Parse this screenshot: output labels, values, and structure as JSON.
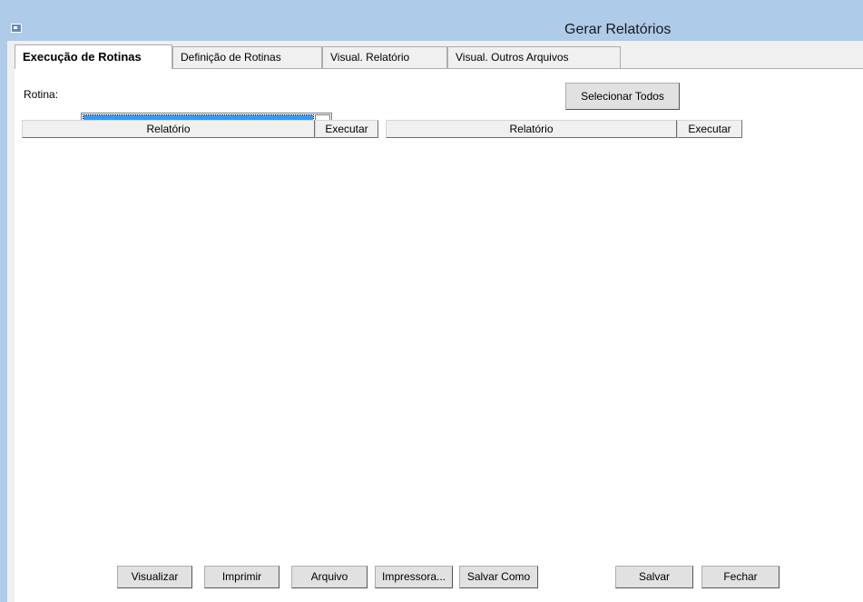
{
  "window": {
    "title": "Gerar Relatórios"
  },
  "tabs": [
    {
      "label": "Execução de Rotinas",
      "active": true
    },
    {
      "label": "Definição de Rotinas",
      "active": false
    },
    {
      "label": "Visual. Relatório",
      "active": false
    },
    {
      "label": "Visual. Outros Arquivos",
      "active": false
    }
  ],
  "form": {
    "rotina_label": "Rotina:",
    "rotina_value": "",
    "select_all_label": "Selecionar Todos"
  },
  "grid": {
    "left": {
      "relatorio": "Relatório",
      "executar": "Executar"
    },
    "right": {
      "relatorio": "Relatório",
      "executar": "Executar"
    }
  },
  "buttons": {
    "visualizar": "Visualizar",
    "imprimir": "Imprimir",
    "arquivo": "Arquivo",
    "impressora": "Impressora...",
    "salvar_como": "Salvar Como",
    "salvar": "Salvar",
    "fechar": "Fechar"
  },
  "colors": {
    "titlebar": "#aecbe9",
    "selection": "#3399ff"
  }
}
